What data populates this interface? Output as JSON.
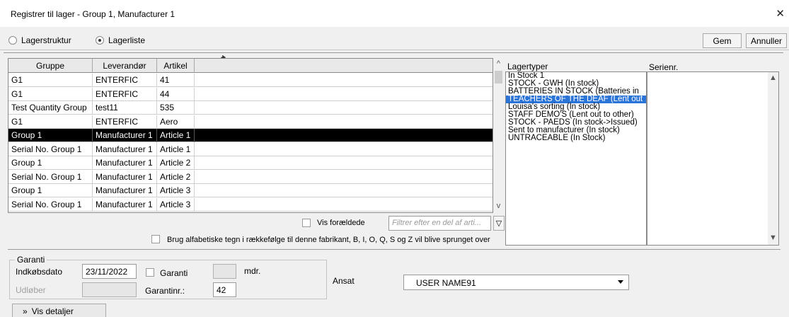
{
  "window": {
    "title": "Registrer til lager - Group 1, Manufacturer 1",
    "close_glyph": "✕"
  },
  "mode": {
    "option1": "Lagerstruktur",
    "option2": "Lagerliste",
    "selected": "Lagerliste"
  },
  "toolbar": {
    "save_label": "Gem",
    "cancel_label": "Annuller"
  },
  "grid": {
    "columns": [
      "Gruppe",
      "Leverandør",
      "Artikel"
    ],
    "rows": [
      [
        "G1",
        "ENTERFIC",
        "41"
      ],
      [
        "G1",
        "ENTERFIC",
        "44"
      ],
      [
        "Test Quantity Group",
        "test11",
        "535"
      ],
      [
        "G1",
        "ENTERFIC",
        "Aero"
      ],
      [
        "Group 1",
        "Manufacturer 1",
        "Article 1"
      ],
      [
        "Serial No. Group 1",
        "Manufacturer 1",
        "Article 1"
      ],
      [
        "Group 1",
        "Manufacturer 1",
        "Article 2"
      ],
      [
        "Serial No. Group 1",
        "Manufacturer 1",
        "Article 2"
      ],
      [
        "Group 1",
        "Manufacturer 1",
        "Article 3"
      ],
      [
        "Serial No. Group 1",
        "Manufacturer 1",
        "Article 3"
      ]
    ],
    "selected_row": 4
  },
  "filters": {
    "show_obsolete_label": "Vis forældede",
    "filter_placeholder": "Filtrer efter en del af arti...",
    "alphabet_note": "Brug alfabetiske tegn i rækkefølge til denne fabrikant, B, I, O, Q, S og Z vil blive sprunget over"
  },
  "lagertyper": {
    "label": "Lagertyper",
    "items": [
      "In Stock 1",
      "STOCK - GWH (In stock)",
      "BATTERIES IN STOCK (Batteries in",
      "TEACHERS OF THE DEAF (Lent out",
      "Louisa's sorting (In stock)",
      "STAFF DEMO'S (Lent out to other)",
      "STOCK - PAEDS (In stock->Issued)",
      "Sent to manufacturer (In stock)",
      "UNTRACEABLE (In Stock)"
    ],
    "selected_index": 3
  },
  "serienr": {
    "label": "Serienr."
  },
  "garanti": {
    "group_label": "Garanti",
    "purchase_date_label": "Indkøbsdato",
    "purchase_date": "23/11/2022",
    "expires_label": "Udløber",
    "expires_value": "",
    "warranty_checkbox_label": "Garanti",
    "months_value": "",
    "months_label": "mdr.",
    "warranty_no_label": "Garantinr.:",
    "warranty_no": "42"
  },
  "employee": {
    "label": "Ansat",
    "value": "USER NAME91"
  },
  "details_button": {
    "glyph": "»",
    "label": "Vis detaljer"
  },
  "colors": {
    "selection_black": "#000000",
    "list_selection_blue": "#2a74d8",
    "background": "#f0f0f0"
  }
}
